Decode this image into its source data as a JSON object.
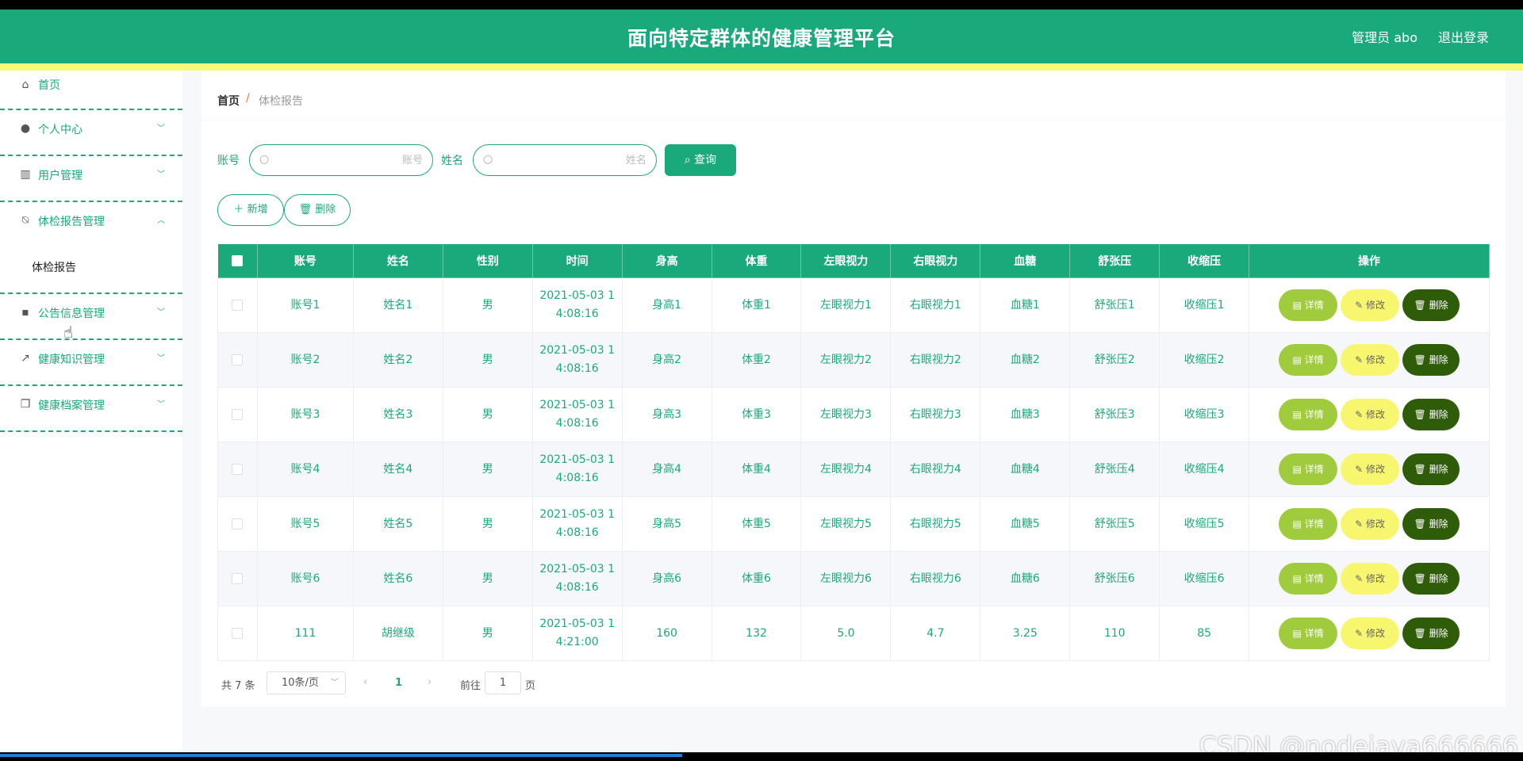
{
  "header": {
    "title": "面向特定群体的健康管理平台",
    "user_label": "管理员 abo",
    "logout_label": "退出登录"
  },
  "sidebar": {
    "items": [
      {
        "label": "首页",
        "icon": "home-icon"
      },
      {
        "label": "个人中心",
        "icon": "user-icon"
      },
      {
        "label": "用户管理",
        "icon": "library-icon"
      },
      {
        "label": "体检报告管理",
        "icon": "bell-off-icon",
        "expanded": true,
        "children": [
          "体检报告"
        ]
      },
      {
        "label": "公告信息管理",
        "icon": "chat-icon"
      },
      {
        "label": "健康知识管理",
        "icon": "trend-icon"
      },
      {
        "label": "健康档案管理",
        "icon": "copy-icon"
      }
    ]
  },
  "breadcrumb": {
    "home": "首页",
    "separator": "/",
    "current": "体检报告"
  },
  "search": {
    "account_label": "账号",
    "account_placeholder": "账号",
    "name_label": "姓名",
    "name_placeholder": "姓名",
    "query_label": "查询"
  },
  "toolbar": {
    "add_label": "新增",
    "delete_label": "删除"
  },
  "table": {
    "columns": [
      "账号",
      "姓名",
      "性别",
      "时间",
      "身高",
      "体重",
      "左眼视力",
      "右眼视力",
      "血糖",
      "舒张压",
      "收缩压",
      "操作"
    ],
    "rows": [
      {
        "account": "账号1",
        "name": "姓名1",
        "gender": "男",
        "time1": "2021-05-03 1",
        "time2": "4:08:16",
        "height": "身高1",
        "weight": "体重1",
        "left_eye": "左眼视力1",
        "right_eye": "右眼视力1",
        "blood_sugar": "血糖1",
        "diastolic": "舒张压1",
        "systolic": "收缩压1"
      },
      {
        "account": "账号2",
        "name": "姓名2",
        "gender": "男",
        "time1": "2021-05-03 1",
        "time2": "4:08:16",
        "height": "身高2",
        "weight": "体重2",
        "left_eye": "左眼视力2",
        "right_eye": "右眼视力2",
        "blood_sugar": "血糖2",
        "diastolic": "舒张压2",
        "systolic": "收缩压2"
      },
      {
        "account": "账号3",
        "name": "姓名3",
        "gender": "男",
        "time1": "2021-05-03 1",
        "time2": "4:08:16",
        "height": "身高3",
        "weight": "体重3",
        "left_eye": "左眼视力3",
        "right_eye": "右眼视力3",
        "blood_sugar": "血糖3",
        "diastolic": "舒张压3",
        "systolic": "收缩压3"
      },
      {
        "account": "账号4",
        "name": "姓名4",
        "gender": "男",
        "time1": "2021-05-03 1",
        "time2": "4:08:16",
        "height": "身高4",
        "weight": "体重4",
        "left_eye": "左眼视力4",
        "right_eye": "右眼视力4",
        "blood_sugar": "血糖4",
        "diastolic": "舒张压4",
        "systolic": "收缩压4"
      },
      {
        "account": "账号5",
        "name": "姓名5",
        "gender": "男",
        "time1": "2021-05-03 1",
        "time2": "4:08:16",
        "height": "身高5",
        "weight": "体重5",
        "left_eye": "左眼视力5",
        "right_eye": "右眼视力5",
        "blood_sugar": "血糖5",
        "diastolic": "舒张压5",
        "systolic": "收缩压5"
      },
      {
        "account": "账号6",
        "name": "姓名6",
        "gender": "男",
        "time1": "2021-05-03 1",
        "time2": "4:08:16",
        "height": "身高6",
        "weight": "体重6",
        "left_eye": "左眼视力6",
        "right_eye": "右眼视力6",
        "blood_sugar": "血糖6",
        "diastolic": "舒张压6",
        "systolic": "收缩压6"
      },
      {
        "account": "111",
        "name": "胡继级",
        "gender": "男",
        "time1": "2021-05-03 1",
        "time2": "4:21:00",
        "height": "160",
        "weight": "132",
        "left_eye": "5.0",
        "right_eye": "4.7",
        "blood_sugar": "3.25",
        "diastolic": "110",
        "systolic": "85"
      }
    ],
    "actions": {
      "detail": "详情",
      "edit": "修改",
      "delete": "删除"
    }
  },
  "pagination": {
    "total": "共 7 条",
    "page_size": "10条/页",
    "current_page": "1",
    "goto_label": "前往",
    "goto_value": "1",
    "page_suffix": "页"
  },
  "watermark": "CSDN @nodejava666666",
  "colors": {
    "primary": "#1aa97b",
    "stripe": "#f7f97a",
    "detail": "#9fcb3c",
    "edit": "#f7f66e",
    "delete": "#2e5c08"
  }
}
